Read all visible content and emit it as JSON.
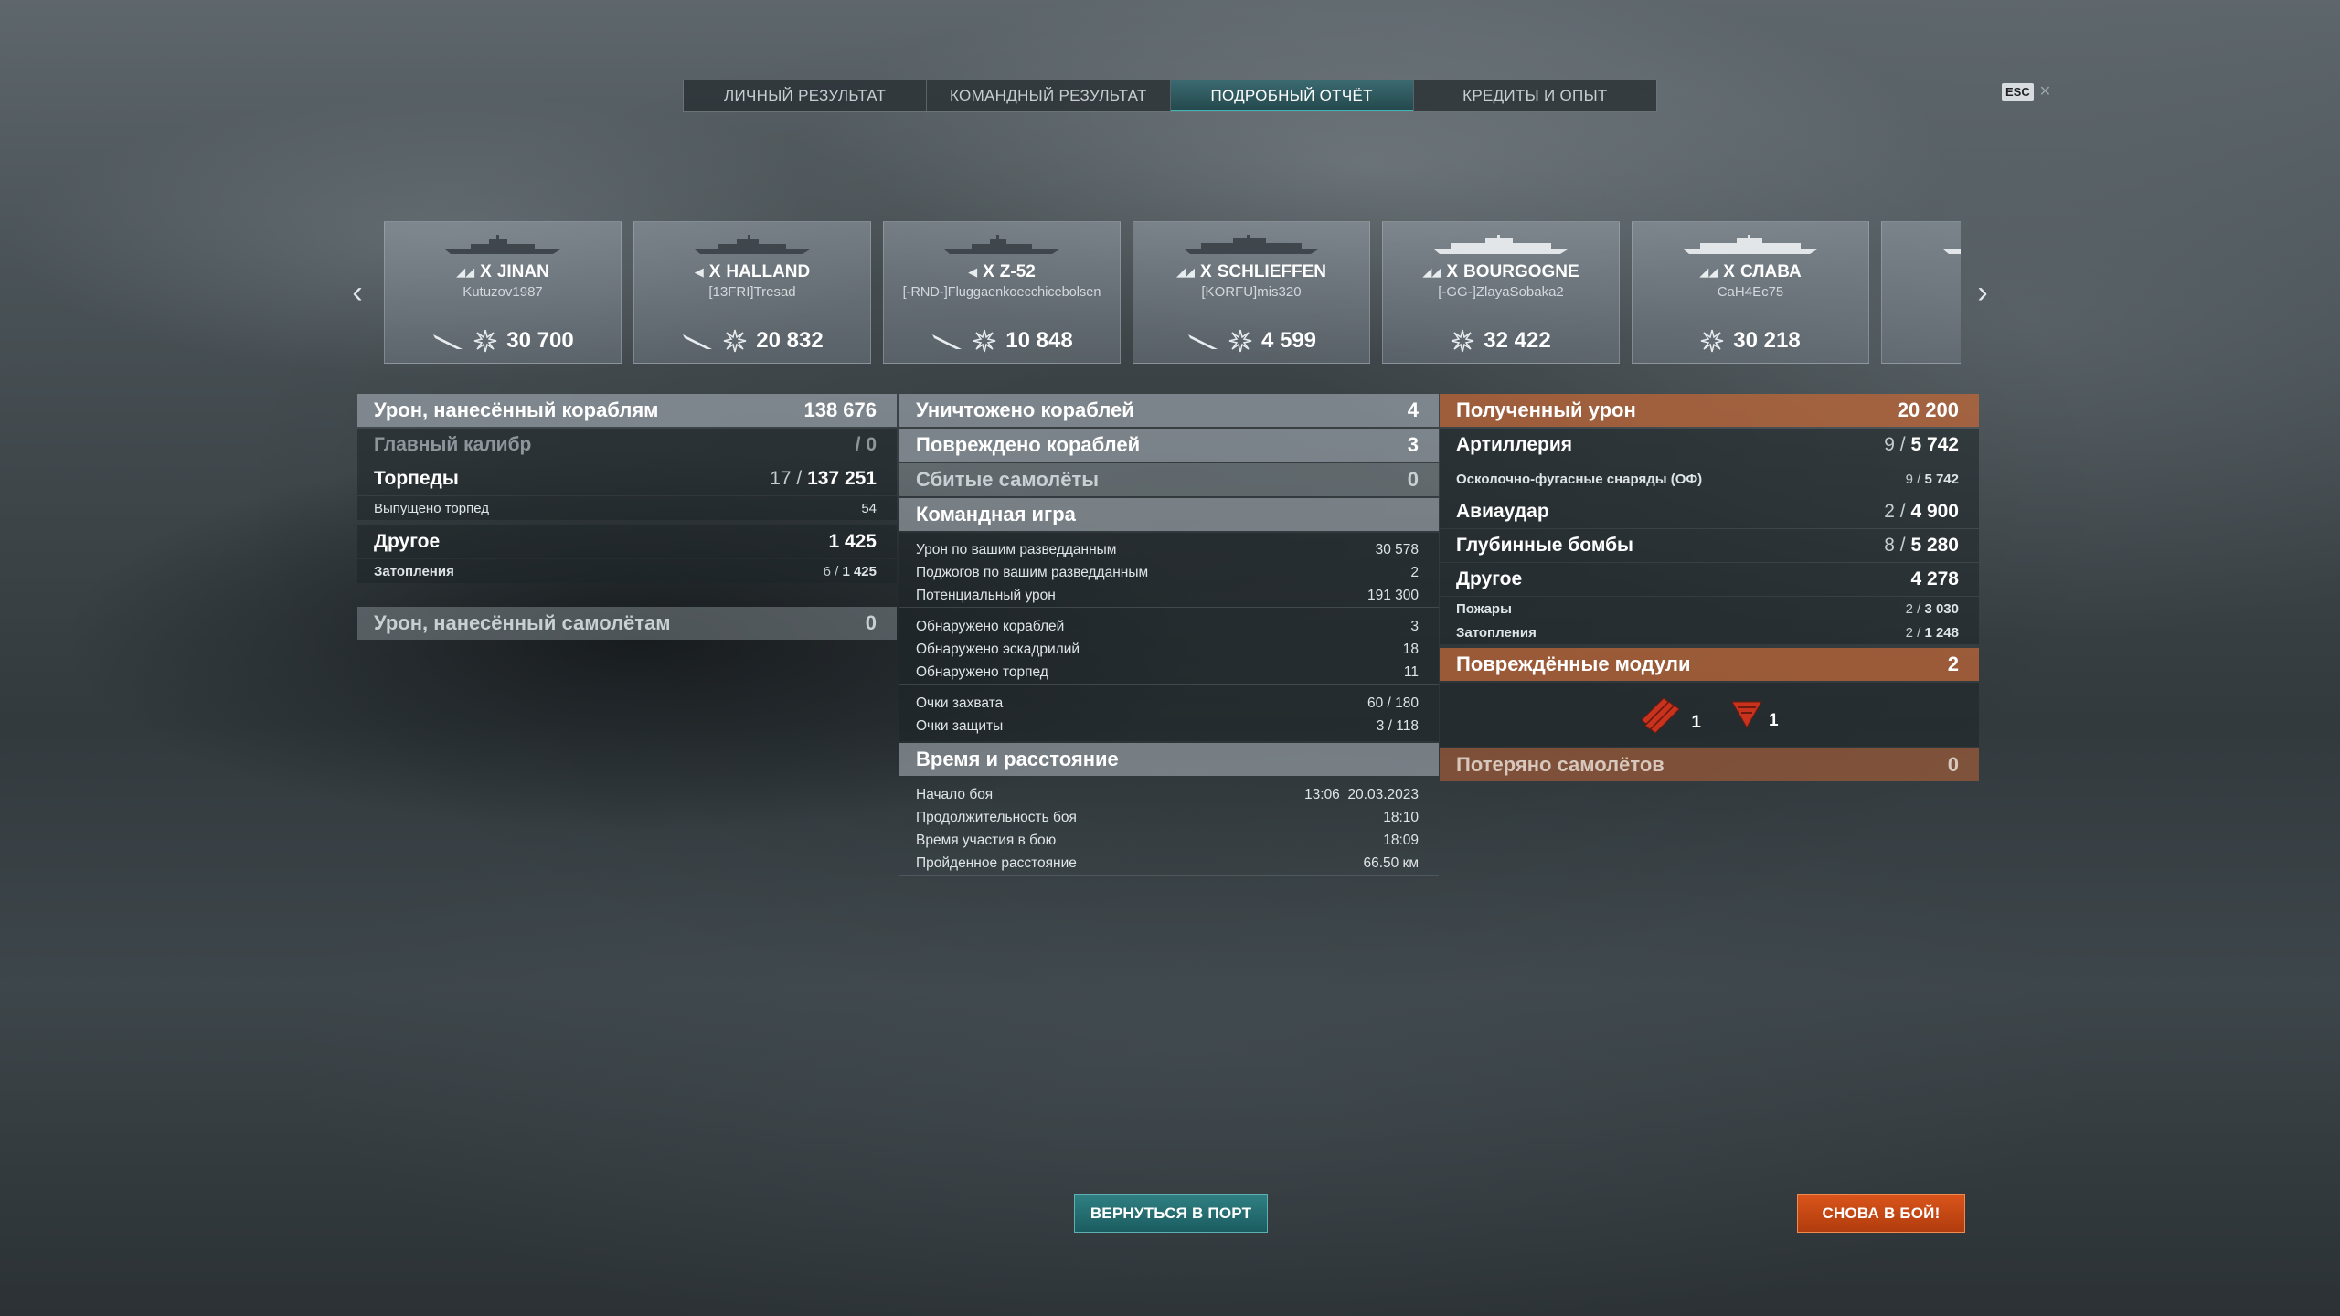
{
  "tabs": [
    {
      "label": "ЛИЧНЫЙ РЕЗУЛЬТАТ",
      "active": false
    },
    {
      "label": "КОМАНДНЫЙ РЕЗУЛЬТАТ",
      "active": false
    },
    {
      "label": "ПОДРОБНЫЙ ОТЧЁТ",
      "active": true
    },
    {
      "label": "КРЕДИТЫ И ОПЫТ",
      "active": false
    }
  ],
  "esc_label": "ESC",
  "ships": [
    {
      "tier": "X",
      "name": "JINAN",
      "player": "Kutuzov1987",
      "damage": "30 700"
    },
    {
      "tier": "X",
      "name": "HALLAND",
      "player": "[13FRI]Tresad",
      "damage": "20 832"
    },
    {
      "tier": "X",
      "name": "Z-52",
      "player": "[-RND-]Fluggaenkoecchicebolsen",
      "damage": "10 848"
    },
    {
      "tier": "X",
      "name": "SCHLIEFFEN",
      "player": "[KORFU]mis320",
      "damage": "4 599"
    },
    {
      "tier": "X",
      "name": "BOURGOGNE",
      "player": "[-GG-]ZlayaSobaka2",
      "damage": "32 422"
    },
    {
      "tier": "X",
      "name": "СЛАВА",
      "player": "CaH4Ec75",
      "damage": "30 218"
    }
  ],
  "left": {
    "ship_damage": {
      "label": "Урон, нанесённый кораблям",
      "value": "138 676"
    },
    "main_battery": {
      "label": "Главный калибр",
      "hits": "",
      "value": "0"
    },
    "torpedoes": {
      "label": "Торпеды",
      "hits": "17",
      "value": "137 251"
    },
    "torps_fired": {
      "label": "Выпущено торпед",
      "value": "54"
    },
    "other": {
      "label": "Другое",
      "value": "1 425"
    },
    "flooding": {
      "label": "Затопления",
      "hits": "6",
      "value": "1 425"
    },
    "plane_damage": {
      "label": "Урон, нанесённый самолётам",
      "value": "0"
    }
  },
  "mid": {
    "destroyed": {
      "label": "Уничтожено кораблей",
      "value": "4"
    },
    "damaged": {
      "label": "Повреждено кораблей",
      "value": "3"
    },
    "planes_shot": {
      "label": "Сбитые самолёты",
      "value": "0"
    },
    "team_play": {
      "title": "Командная игра",
      "rows": [
        {
          "label": "Урон по вашим разведданным",
          "value": "30 578"
        },
        {
          "label": "Поджогов по вашим разведданным",
          "value": "2"
        },
        {
          "label": "Потенциальный урон",
          "value": "191 300"
        },
        {
          "label": "Обнаружено кораблей",
          "value": "3"
        },
        {
          "label": "Обнаружено эскадрилий",
          "value": "18"
        },
        {
          "label": "Обнаружено торпед",
          "value": "11"
        },
        {
          "label": "Очки захвата",
          "value": "60 / 180"
        },
        {
          "label": "Очки защиты",
          "value": "3 / 118"
        }
      ]
    },
    "time_distance": {
      "title": "Время и расстояние",
      "rows": [
        {
          "label": "Начало боя",
          "value": "13:06  20.03.2023"
        },
        {
          "label": "Продолжительность боя",
          "value": "18:10"
        },
        {
          "label": "Время участия в бою",
          "value": "18:09"
        },
        {
          "label": "Пройденное расстояние",
          "value": "66.50 км"
        }
      ]
    }
  },
  "right": {
    "received": {
      "label": "Полученный урон",
      "value": "20 200"
    },
    "artillery": {
      "label": "Артиллерия",
      "hits": "9",
      "value": "5 742"
    },
    "he_shells": {
      "label": "Осколочно-фугасные снаряды (ОФ)",
      "hits": "9",
      "value": "5 742"
    },
    "airstrike": {
      "label": "Авиаудар",
      "hits": "2",
      "value": "4 900"
    },
    "depth_charges": {
      "label": "Глубинные бомбы",
      "hits": "8",
      "value": "5 280"
    },
    "other": {
      "label": "Другое",
      "value": "4 278"
    },
    "fires": {
      "label": "Пожары",
      "hits": "2",
      "value": "3 030"
    },
    "flooding": {
      "label": "Затопления",
      "hits": "2",
      "value": "1 248"
    },
    "modules": {
      "label": "Повреждённые модули",
      "value": "2",
      "items": [
        {
          "icon": "torpedo-tubes-icon",
          "count": "1"
        },
        {
          "icon": "steering-gear-icon",
          "count": "1"
        }
      ]
    },
    "planes_lost": {
      "label": "Потеряно самолётов",
      "value": "0"
    }
  },
  "buttons": {
    "port": "ВЕРНУТЬСЯ В ПОРТ",
    "battle": "СНОВА В БОЙ!"
  },
  "colors": {
    "accent_teal": "#1b5c60",
    "accent_orange": "#c46837",
    "battle_button": "#d9541a"
  }
}
